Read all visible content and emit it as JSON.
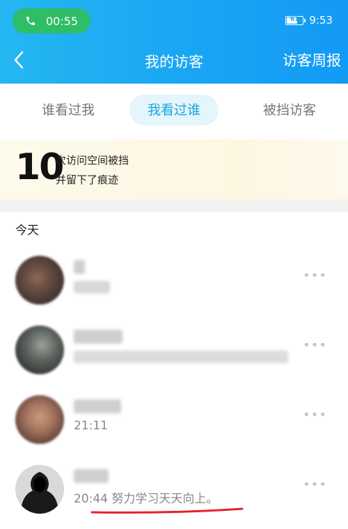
{
  "status_bar": {
    "call_time": "00:55",
    "battery_level": "61",
    "clock": "9:53"
  },
  "nav": {
    "title": "我的访客",
    "right_action": "访客周报"
  },
  "tabs": [
    {
      "label": "谁看过我",
      "active": false
    },
    {
      "label": "我看过谁",
      "active": true
    },
    {
      "label": "被挡访客",
      "active": false
    }
  ],
  "banner": {
    "count": "10",
    "line1": "次访问空间被挡",
    "line2": "并留下了痕迹"
  },
  "section_title": "今天",
  "items": [
    {
      "visible_text": ""
    },
    {
      "visible_text": ""
    },
    {
      "visible_text": "21:11"
    },
    {
      "visible_text": "20:44 努力学习天天向上。"
    }
  ],
  "more_glyph": "•••",
  "colors": {
    "header": "#1aa7f3",
    "call_pill": "#2fbd66",
    "active_tab_text": "#19a6e0",
    "underline_mark": "#e8202a"
  }
}
